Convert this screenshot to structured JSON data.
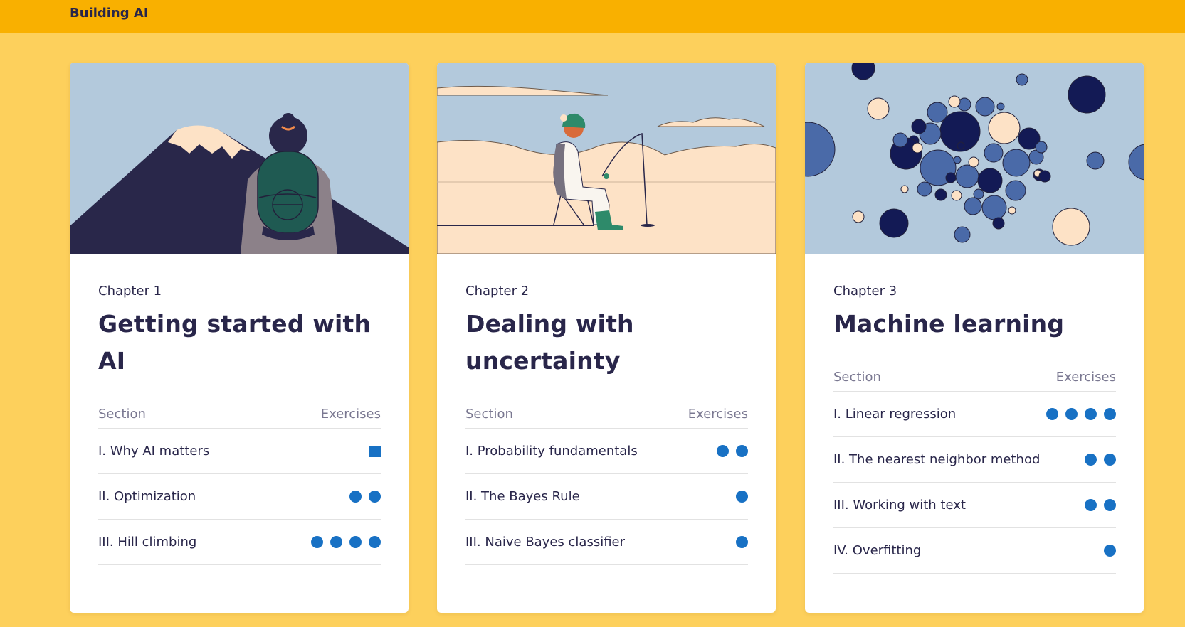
{
  "header": {
    "brand": "Building AI"
  },
  "columns": {
    "section": "Section",
    "exercises": "Exercises"
  },
  "colors": {
    "accent": "#1871c4",
    "background": "#fdd05c",
    "header": "#f9b000"
  },
  "chapters": [
    {
      "label": "Chapter 1",
      "title": "Getting started with AI",
      "sections": [
        {
          "title": "I. Why AI matters",
          "exercises": 1,
          "marker": "square"
        },
        {
          "title": "II. Optimization",
          "exercises": 2,
          "marker": "dot"
        },
        {
          "title": "III. Hill climbing",
          "exercises": 4,
          "marker": "dot"
        }
      ]
    },
    {
      "label": "Chapter 2",
      "title": "Dealing with uncertainty",
      "sections": [
        {
          "title": "I. Probability fundamentals",
          "exercises": 2,
          "marker": "dot"
        },
        {
          "title": "II. The Bayes Rule",
          "exercises": 1,
          "marker": "dot"
        },
        {
          "title": "III. Naive Bayes classifier",
          "exercises": 1,
          "marker": "dot"
        }
      ]
    },
    {
      "label": "Chapter 3",
      "title": "Machine learning",
      "sections": [
        {
          "title": "I. Linear regression",
          "exercises": 4,
          "marker": "dot"
        },
        {
          "title": "II. The nearest neighbor method",
          "exercises": 2,
          "marker": "dot"
        },
        {
          "title": "III. Working with text",
          "exercises": 2,
          "marker": "dot"
        },
        {
          "title": "IV. Overfitting",
          "exercises": 1,
          "marker": "dot"
        }
      ]
    }
  ]
}
